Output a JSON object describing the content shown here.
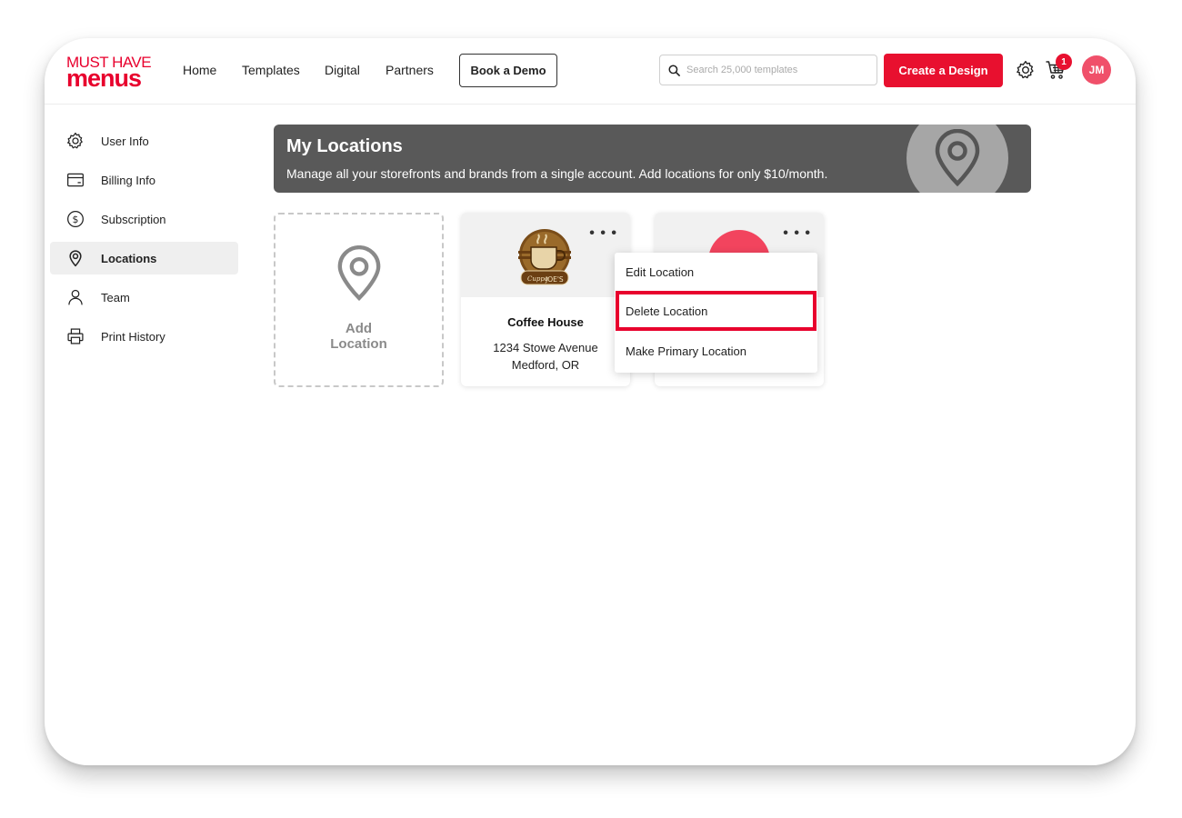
{
  "header": {
    "logo_line1": "MUST HAVE",
    "logo_line2": "menus",
    "nav": [
      "Home",
      "Templates",
      "Digital",
      "Partners"
    ],
    "demo_label": "Book a Demo",
    "search_placeholder": "Search 25,000 templates",
    "create_label": "Create a Design",
    "cart_count": "1",
    "avatar_initials": "JM"
  },
  "sidebar": {
    "items": [
      {
        "label": "User Info",
        "icon": "gear-icon"
      },
      {
        "label": "Billing Info",
        "icon": "card-icon"
      },
      {
        "label": "Subscription",
        "icon": "dollar-icon"
      },
      {
        "label": "Locations",
        "icon": "location-pin-icon",
        "active": true
      },
      {
        "label": "Team",
        "icon": "person-icon"
      },
      {
        "label": "Print History",
        "icon": "printer-icon"
      }
    ]
  },
  "banner": {
    "title": "My Locations",
    "subtitle": "Manage all your storefronts and brands from a single account. Add locations for only $10/month."
  },
  "add_card": {
    "label": "Add Location"
  },
  "locations": [
    {
      "name": "Coffee House",
      "address_line1": "1234 Stowe Avenue",
      "address_line2": "Medford, OR",
      "logo_text_1": "Cuppa",
      "logo_text_2": "JOE'S"
    }
  ],
  "menu": {
    "items": [
      "Edit Location",
      "Delete Location",
      "Make Primary Location"
    ],
    "highlighted": "Delete Location"
  },
  "colors": {
    "brand": "#e8002d",
    "banner_bg": "#595959",
    "avatar_bg": "#f0506a"
  }
}
